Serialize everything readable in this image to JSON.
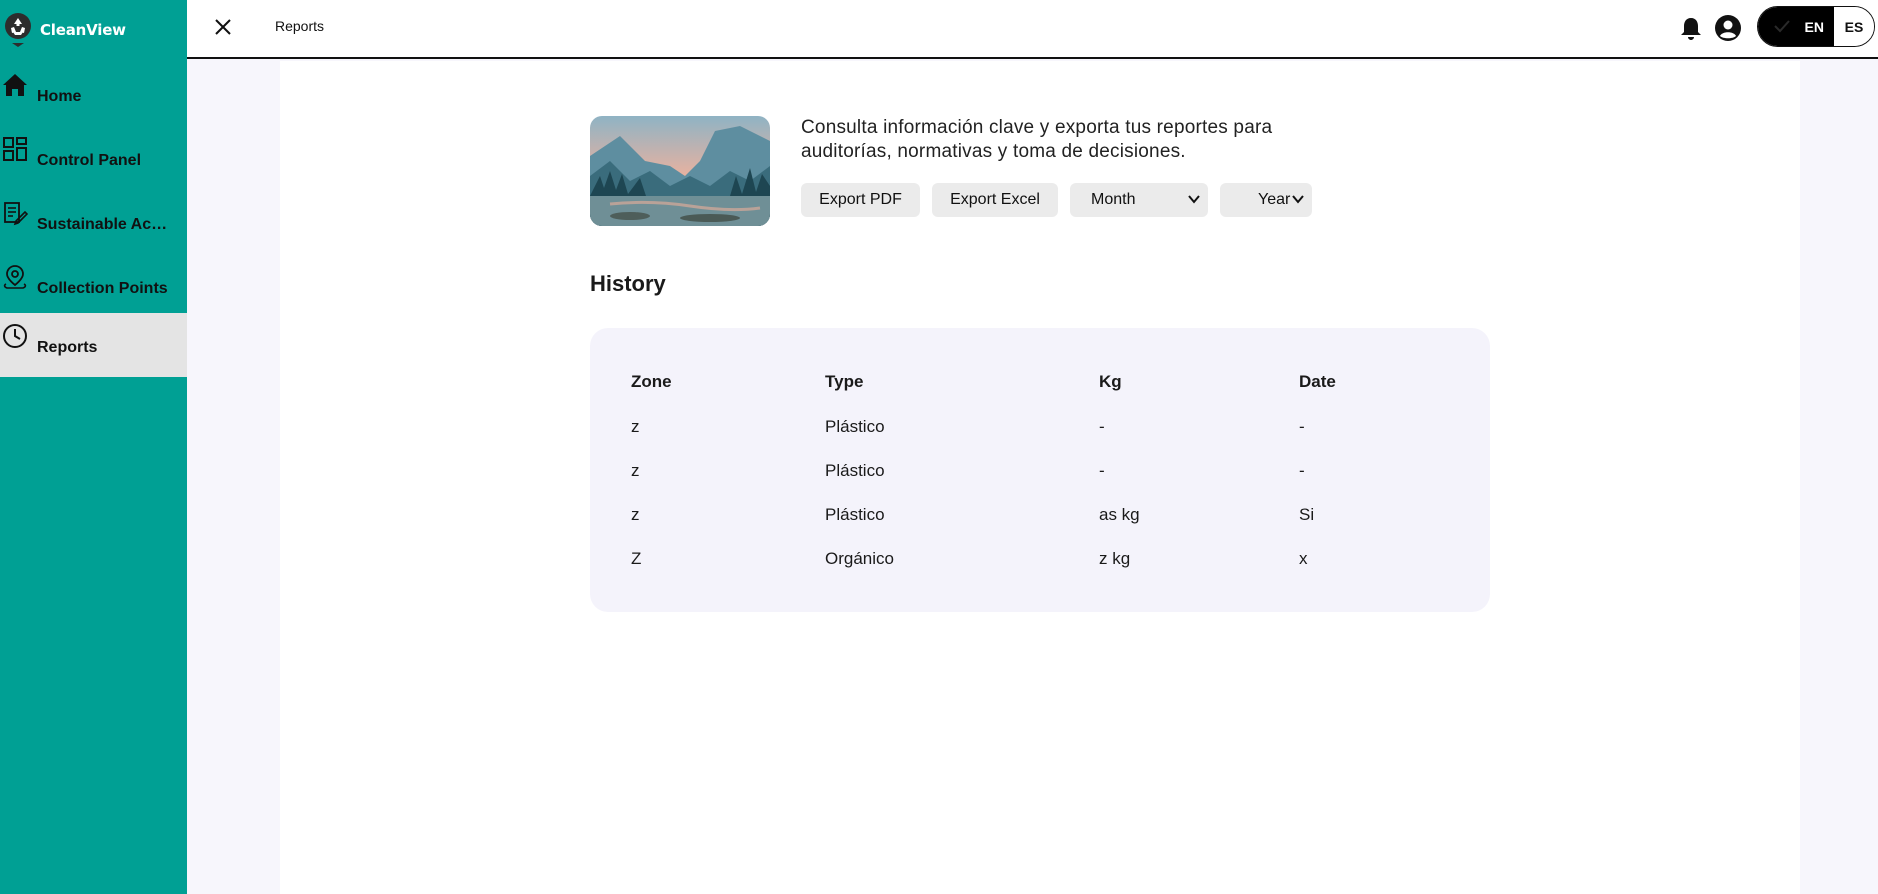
{
  "app": {
    "name": "CleanView"
  },
  "sidebar": {
    "items": [
      {
        "label": "Home",
        "icon": "home-icon"
      },
      {
        "label": "Control Panel",
        "icon": "dashboard-icon"
      },
      {
        "label": "Sustainable Act...",
        "icon": "edit-document-icon"
      },
      {
        "label": "Collection Points",
        "icon": "location-pin-icon"
      },
      {
        "label": "Reports",
        "icon": "clock-icon",
        "active": true
      }
    ]
  },
  "header": {
    "title": "Reports",
    "language": {
      "options": [
        "EN",
        "ES"
      ],
      "selected": "EN"
    }
  },
  "main": {
    "description": "Consulta información clave y exporta tus reportes para auditorías, normativas y toma de decisiones.",
    "export_pdf_label": "Export PDF",
    "export_excel_label": "Export Excel",
    "month_select": "Month",
    "year_select": "Year",
    "history_title": "History",
    "table": {
      "headers": [
        "Zone",
        "Type",
        "Kg",
        "Date"
      ],
      "rows": [
        [
          "z",
          "Plástico",
          "-",
          "-"
        ],
        [
          "z",
          "Plástico",
          "-",
          "-"
        ],
        [
          "z",
          "Plástico",
          "as kg",
          "Si"
        ],
        [
          "Z",
          "Orgánico",
          "z kg",
          "x"
        ]
      ]
    }
  },
  "colors": {
    "sidebar": "#00a094",
    "active_item": "#e4e4e4",
    "page_background": "#f7f6fc",
    "table_background": "#f4f3fb",
    "button": "#ebebeb"
  }
}
